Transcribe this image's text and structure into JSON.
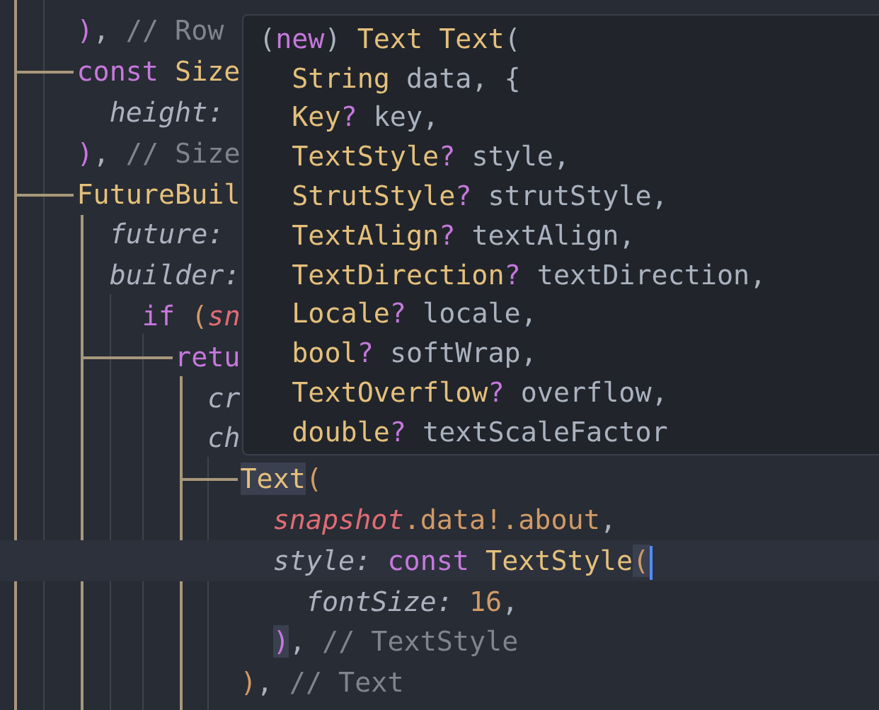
{
  "editor": {
    "lines": [
      {
        "current": false,
        "tokens": [
          {
            "kind": "bracket-b",
            "text": "    )"
          },
          {
            "kind": "plain",
            "text": ", "
          },
          {
            "kind": "comment",
            "text": "// Row"
          }
        ]
      },
      {
        "current": false,
        "tokens": [
          {
            "kind": "keyword",
            "text": "    const "
          },
          {
            "kind": "type",
            "text": "Size"
          }
        ]
      },
      {
        "current": false,
        "tokens": [
          {
            "kind": "param",
            "text": "      height:"
          }
        ]
      },
      {
        "current": false,
        "tokens": [
          {
            "kind": "bracket-b",
            "text": "    )"
          },
          {
            "kind": "plain",
            "text": ", "
          },
          {
            "kind": "comment",
            "text": "// Size"
          }
        ]
      },
      {
        "current": false,
        "tokens": [
          {
            "kind": "type",
            "text": "    FutureBuil"
          }
        ]
      },
      {
        "current": false,
        "tokens": [
          {
            "kind": "param",
            "text": "      future:"
          }
        ]
      },
      {
        "current": false,
        "tokens": [
          {
            "kind": "param",
            "text": "      builder:"
          }
        ]
      },
      {
        "current": false,
        "tokens": [
          {
            "kind": "keyword",
            "text": "        if "
          },
          {
            "kind": "bracket-a",
            "text": "("
          },
          {
            "kind": "variable",
            "text": "sn"
          }
        ]
      },
      {
        "current": false,
        "tokens": [
          {
            "kind": "keyword",
            "text": "          retu"
          }
        ]
      },
      {
        "current": false,
        "tokens": [
          {
            "kind": "param",
            "text": "            cr"
          }
        ]
      },
      {
        "current": false,
        "tokens": [
          {
            "kind": "param",
            "text": "            ch"
          }
        ]
      },
      {
        "current": false,
        "tokens": [
          {
            "kind": "type",
            "text": "              Text",
            "highlighted": true
          },
          {
            "kind": "bracket-a",
            "text": "(",
            "highlighted": false
          }
        ]
      },
      {
        "current": false,
        "tokens": [
          {
            "kind": "variable",
            "text": "                snapshot"
          },
          {
            "kind": "property",
            "text": ".data!.about"
          },
          {
            "kind": "plain",
            "text": ","
          }
        ]
      },
      {
        "current": true,
        "tokens": [
          {
            "kind": "param",
            "text": "                style: "
          },
          {
            "kind": "keyword",
            "text": "const "
          },
          {
            "kind": "type",
            "text": "TextStyle",
            "highlighted": false
          },
          {
            "kind": "bracket-a",
            "text": "(",
            "highlighted": true,
            "cursor": true
          }
        ]
      },
      {
        "current": false,
        "tokens": [
          {
            "kind": "param",
            "text": "                  fontSize: "
          },
          {
            "kind": "number",
            "text": "16"
          },
          {
            "kind": "plain",
            "text": ","
          }
        ]
      },
      {
        "current": false,
        "tokens": [
          {
            "kind": "bracket-b",
            "text": "                )",
            "highlighted": true
          },
          {
            "kind": "plain",
            "text": ", "
          },
          {
            "kind": "comment",
            "text": "// TextStyle"
          }
        ]
      },
      {
        "current": false,
        "tokens": [
          {
            "kind": "bracket-a",
            "text": "              )"
          },
          {
            "kind": "plain",
            "text": ", "
          },
          {
            "kind": "comment",
            "text": "// Text"
          }
        ]
      }
    ]
  },
  "hover": {
    "lines": [
      {
        "tokens": [
          {
            "kind": "plain",
            "text": "("
          },
          {
            "kind": "keyword",
            "text": "new"
          },
          {
            "kind": "plain",
            "text": ") "
          },
          {
            "kind": "type",
            "text": "Text Text"
          },
          {
            "kind": "plain",
            "text": "("
          }
        ]
      },
      {
        "tokens": [
          {
            "kind": "type",
            "text": "  String"
          },
          {
            "kind": "plain",
            "text": " data, {"
          }
        ]
      },
      {
        "tokens": [
          {
            "kind": "type",
            "text": "  Key"
          },
          {
            "kind": "keyword",
            "text": "?"
          },
          {
            "kind": "plain",
            "text": " key,"
          }
        ]
      },
      {
        "tokens": [
          {
            "kind": "type",
            "text": "  TextStyle"
          },
          {
            "kind": "keyword",
            "text": "?"
          },
          {
            "kind": "plain",
            "text": " style,"
          }
        ]
      },
      {
        "tokens": [
          {
            "kind": "type",
            "text": "  StrutStyle"
          },
          {
            "kind": "keyword",
            "text": "?"
          },
          {
            "kind": "plain",
            "text": " strutStyle,"
          }
        ]
      },
      {
        "tokens": [
          {
            "kind": "type",
            "text": "  TextAlign"
          },
          {
            "kind": "keyword",
            "text": "?"
          },
          {
            "kind": "plain",
            "text": " textAlign,"
          }
        ]
      },
      {
        "tokens": [
          {
            "kind": "type",
            "text": "  TextDirection"
          },
          {
            "kind": "keyword",
            "text": "?"
          },
          {
            "kind": "plain",
            "text": " textDirection,"
          }
        ]
      },
      {
        "tokens": [
          {
            "kind": "type",
            "text": "  Locale"
          },
          {
            "kind": "keyword",
            "text": "?"
          },
          {
            "kind": "plain",
            "text": " locale,"
          }
        ]
      },
      {
        "tokens": [
          {
            "kind": "type",
            "text": "  bool"
          },
          {
            "kind": "keyword",
            "text": "?"
          },
          {
            "kind": "plain",
            "text": " softWrap,"
          }
        ]
      },
      {
        "tokens": [
          {
            "kind": "type",
            "text": "  TextOverflow"
          },
          {
            "kind": "keyword",
            "text": "?"
          },
          {
            "kind": "plain",
            "text": " overflow,"
          }
        ]
      },
      {
        "tokens": [
          {
            "kind": "type",
            "text": "  double"
          },
          {
            "kind": "keyword",
            "text": "?"
          },
          {
            "kind": "plain",
            "text": " textScaleFactor"
          }
        ]
      }
    ]
  }
}
